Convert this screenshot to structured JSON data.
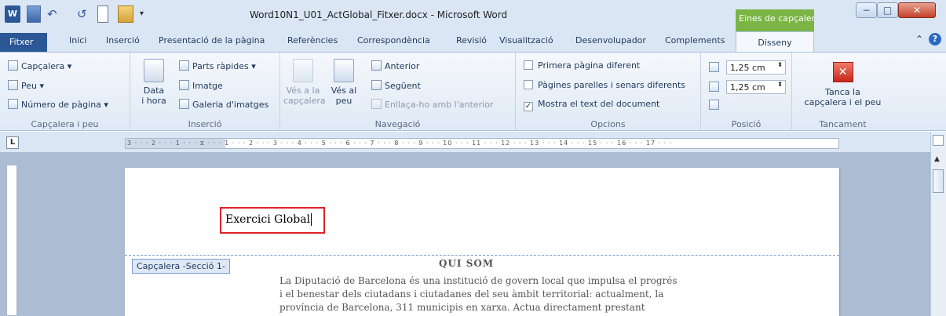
{
  "window": {
    "title": "Word10N1_U01_ActGlobal_Fitxer.docx - Microsoft Word",
    "context_title": "Eines de capçalera i ...",
    "word_icon": "W"
  },
  "tabs": [
    "Fitxer",
    "Inici",
    "Inserció",
    "Presentació de la pàgina",
    "Referències",
    "Correspondència",
    "Revisió",
    "Visualització",
    "Desenvolupador",
    "Complements"
  ],
  "context_tab": "Disseny",
  "ribbon": {
    "header_footer": {
      "header": "Capçalera",
      "footer": "Peu",
      "page_number": "Número de pàgina",
      "label": "Capçalera i peu"
    },
    "insert": {
      "date_l1": "Data",
      "date_l2": "i hora",
      "quick_parts": "Parts ràpides",
      "image": "Imatge",
      "clipart": "Galeria d'imatges",
      "label": "Inserció"
    },
    "navigation": {
      "goto_header_l1": "Vés a la",
      "goto_header_l2": "capçalera",
      "goto_footer_l1": "Vés al",
      "goto_footer_l2": "peu",
      "previous": "Anterior",
      "next": "Següent",
      "link_previous": "Enllaça-ho amb l'anterior",
      "label": "Navegació"
    },
    "options": {
      "first_page": "Primera pàgina diferent",
      "odd_even": "Pàgines parelles i senars diferents",
      "show_text": "Mostra el text del document",
      "show_text_checked": true,
      "label": "Opcions"
    },
    "position": {
      "header_pos": "1,25 cm",
      "footer_pos": "1,25 cm",
      "label": "Posició"
    },
    "close": {
      "l1": "Tanca la",
      "l2": "capçalera i el peu",
      "label": "Tancament"
    }
  },
  "ruler": {
    "marks": "3 · · · 2 · · · 1 · · · ⧖ · · · 1 · · · 2 · · · 3 · · · 4 · · · 5 · · · 6 · · · 7 · · · 8 · · · 9 · · · 10 · · · 11 · · · 12 · · · 13 · · · 14 · · · 15 · · · 16 · · · 17 · · ·"
  },
  "document": {
    "header_text": "Exercici Global",
    "header_tag": "Capçalera -Secció 1-",
    "heading": "QUI SOM",
    "body_lines": [
      "La Diputació de Barcelona és una institució de govern local que impulsa el progrés",
      "i el benestar dels ciutadans i ciutadanes del seu àmbit territorial: actualment, la",
      "província de Barcelona, 311 municipis en xarxa. Actua directament prestant"
    ]
  }
}
